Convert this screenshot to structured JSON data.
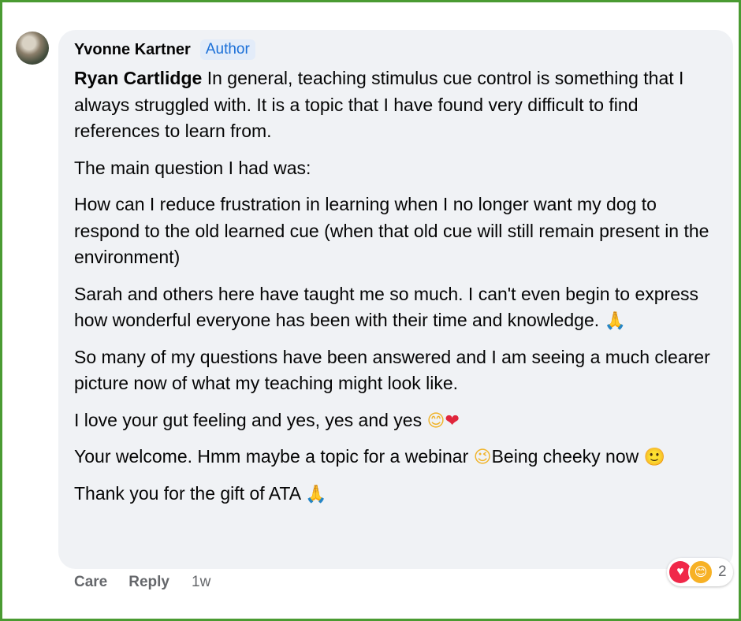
{
  "comment": {
    "author": "Yvonne Kartner",
    "badge": "Author",
    "mention": "Ryan Cartlidge",
    "paragraphs": [
      {
        "text": " In general, teaching stimulus cue control is something that I always struggled with. It is a topic that I have found very difficult to find references to learn from."
      },
      {
        "text": "The main question I had was:"
      },
      {
        "text": "How can I reduce frustration in learning when I no longer want my dog to respond to the old learned cue (when that old cue will still remain present in the environment)"
      },
      {
        "text": "Sarah and others here have taught me so much. I can't even begin to express how wonderful everyone has been with their time and knowledge. "
      },
      {
        "text": "So many of my questions have been answered and I am seeing a much clearer picture now of what my teaching might look like."
      },
      {
        "text": "I love your gut feeling and yes, yes and yes "
      },
      {
        "text": "Your welcome. Hmm maybe a topic for a webinar ",
        "after": "Being cheeky now "
      },
      {
        "text": "Thank you for the gift of ATA "
      }
    ],
    "emojis": {
      "pray": "🙏",
      "blush": "😊",
      "heart": "❤",
      "wink": "😉",
      "smile": "🙂"
    }
  },
  "actions": {
    "care": "Care",
    "reply": "Reply",
    "time": "1w"
  },
  "reactions": {
    "love_icon": "heart-icon",
    "care_icon": "care-icon",
    "count": "2",
    "love_glyph": "♥",
    "care_glyph": "😊"
  },
  "colors": {
    "frame": "#4a9b32",
    "bubble": "#f0f2f5",
    "badge_text": "#1a6fd8",
    "secondary_text": "#65676b"
  }
}
